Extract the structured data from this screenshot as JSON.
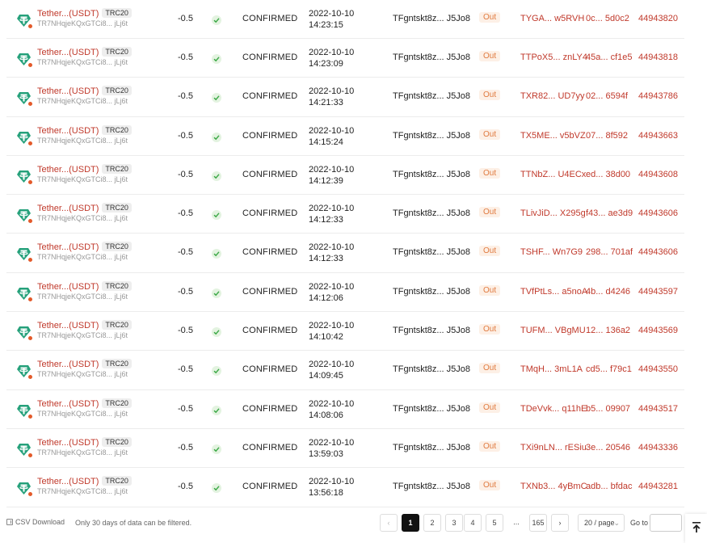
{
  "token": {
    "name": "Tether...(USDT)",
    "badge": "TRC20",
    "address": "TR7NHqjeKQxGTCi8... jLj6t"
  },
  "rows": [
    {
      "amount": "-0.5",
      "status": "CONFIRMED",
      "date": "2022-10-10",
      "time": "14:23:15",
      "from": "TFgntskt8z... J5Jo8",
      "direction": "Out",
      "to": "TYGA... w5RVH",
      "hash": "0c... 5d0c2",
      "block": "44943820"
    },
    {
      "amount": "-0.5",
      "status": "CONFIRMED",
      "date": "2022-10-10",
      "time": "14:23:09",
      "from": "TFgntskt8z... J5Jo8",
      "direction": "Out",
      "to": "TTPoX5... znLY4",
      "hash": "45a... cf1e5",
      "block": "44943818"
    },
    {
      "amount": "-0.5",
      "status": "CONFIRMED",
      "date": "2022-10-10",
      "time": "14:21:33",
      "from": "TFgntskt8z... J5Jo8",
      "direction": "Out",
      "to": "TXR82... UD7yy",
      "hash": "02... 6594f",
      "block": "44943786"
    },
    {
      "amount": "-0.5",
      "status": "CONFIRMED",
      "date": "2022-10-10",
      "time": "14:15:24",
      "from": "TFgntskt8z... J5Jo8",
      "direction": "Out",
      "to": "TX5ME... v5bVZ",
      "hash": "07... 8f592",
      "block": "44943663"
    },
    {
      "amount": "-0.5",
      "status": "CONFIRMED",
      "date": "2022-10-10",
      "time": "14:12:39",
      "from": "TFgntskt8z... J5Jo8",
      "direction": "Out",
      "to": "TTNbZ... U4ECx",
      "hash": "ed... 38d00",
      "block": "44943608"
    },
    {
      "amount": "-0.5",
      "status": "CONFIRMED",
      "date": "2022-10-10",
      "time": "14:12:33",
      "from": "TFgntskt8z... J5Jo8",
      "direction": "Out",
      "to": "TLivJiD... X295g",
      "hash": "f43... ae3d9",
      "block": "44943606"
    },
    {
      "amount": "-0.5",
      "status": "CONFIRMED",
      "date": "2022-10-10",
      "time": "14:12:33",
      "from": "TFgntskt8z... J5Jo8",
      "direction": "Out",
      "to": "TSHF... Wn7G9",
      "hash": "298... 701af",
      "block": "44943606"
    },
    {
      "amount": "-0.5",
      "status": "CONFIRMED",
      "date": "2022-10-10",
      "time": "14:12:06",
      "from": "TFgntskt8z... J5Jo8",
      "direction": "Out",
      "to": "TVfPtLs... a5noA",
      "hash": "4b... d4246",
      "block": "44943597"
    },
    {
      "amount": "-0.5",
      "status": "CONFIRMED",
      "date": "2022-10-10",
      "time": "14:10:42",
      "from": "TFgntskt8z... J5Jo8",
      "direction": "Out",
      "to": "TUFM... VBgMU",
      "hash": "12... 136a2",
      "block": "44943569"
    },
    {
      "amount": "-0.5",
      "status": "CONFIRMED",
      "date": "2022-10-10",
      "time": "14:09:45",
      "from": "TFgntskt8z... J5Jo8",
      "direction": "Out",
      "to": "TMqH... 3mL1A",
      "hash": "cd5... f79c1",
      "block": "44943550"
    },
    {
      "amount": "-0.5",
      "status": "CONFIRMED",
      "date": "2022-10-10",
      "time": "14:08:06",
      "from": "TFgntskt8z... J5Jo8",
      "direction": "Out",
      "to": "TDeVvk... q11hE",
      "hash": "b5... 09907",
      "block": "44943517"
    },
    {
      "amount": "-0.5",
      "status": "CONFIRMED",
      "date": "2022-10-10",
      "time": "13:59:03",
      "from": "TFgntskt8z... J5Jo8",
      "direction": "Out",
      "to": "TXi9nLN... rESiu",
      "hash": "3e... 20546",
      "block": "44943336"
    },
    {
      "amount": "-0.5",
      "status": "CONFIRMED",
      "date": "2022-10-10",
      "time": "13:56:18",
      "from": "TFgntskt8z... J5Jo8",
      "direction": "Out",
      "to": "TXNb3... 4yBmC",
      "hash": "adb... bfdac",
      "block": "44943281"
    }
  ],
  "footer": {
    "csv_label": "CSV Download",
    "note": "Only 30 days of data can be filtered.",
    "pages": [
      "1",
      "2",
      "3",
      "4",
      "5",
      "...",
      "165"
    ],
    "current_page": "1",
    "prev": "‹",
    "next": "›",
    "page_size": "20 / page",
    "goto_label": "Go to",
    "goto_value": ""
  },
  "colors": {
    "link": "#c0392b",
    "out": "#e07a3f",
    "ok": "#3aa845",
    "usdt": "#26a17b"
  }
}
